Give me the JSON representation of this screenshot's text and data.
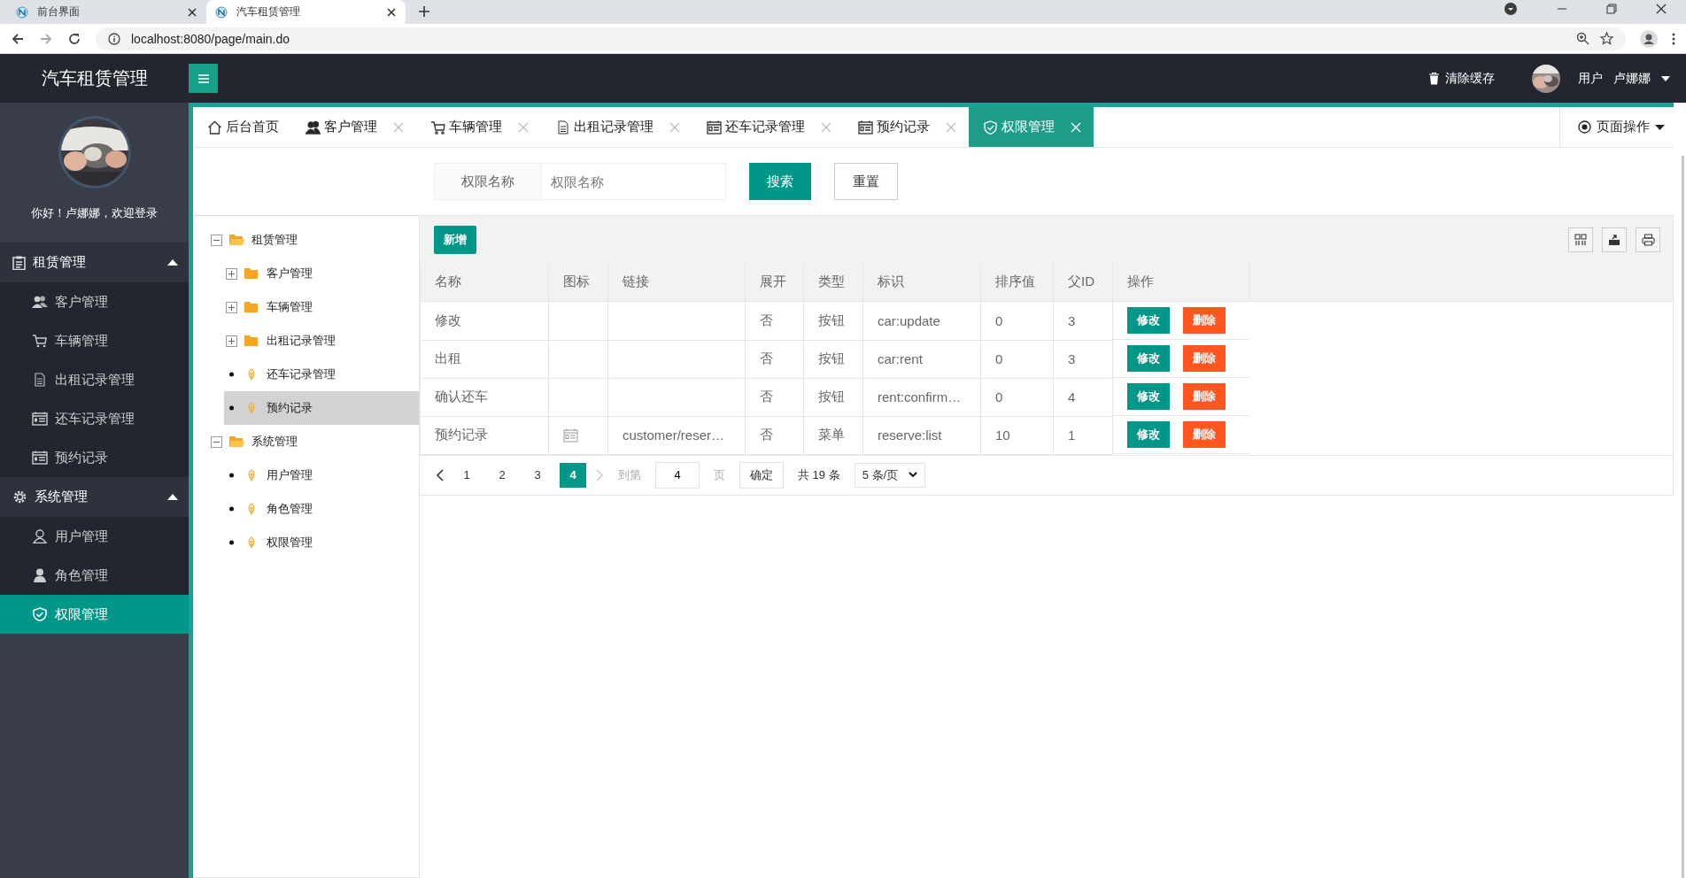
{
  "browser": {
    "tabs": [
      {
        "title": "前台界面",
        "selected": false
      },
      {
        "title": "汽车租赁管理",
        "selected": true
      }
    ],
    "address": "localhost:8080/page/main.do"
  },
  "header": {
    "title": "汽车租赁管理",
    "clear_cache": "清除缓存",
    "user_label": "用户",
    "user_name": "卢娜娜"
  },
  "sidebar": {
    "greeting": "你好！卢娜娜，欢迎登录",
    "groups": [
      {
        "label": "租赁管理",
        "expanded": true,
        "items": [
          {
            "label": "客户管理",
            "selected": false
          },
          {
            "label": "车辆管理",
            "selected": false
          },
          {
            "label": "出租记录管理",
            "selected": false
          },
          {
            "label": "还车记录管理",
            "selected": false
          },
          {
            "label": "预约记录",
            "selected": false
          }
        ]
      },
      {
        "label": "系统管理",
        "expanded": true,
        "items": [
          {
            "label": "用户管理",
            "selected": false
          },
          {
            "label": "角色管理",
            "selected": false
          },
          {
            "label": "权限管理",
            "selected": true
          }
        ]
      }
    ]
  },
  "page_tabs": [
    {
      "label": "后台首页",
      "selected": false,
      "closable": false
    },
    {
      "label": "客户管理",
      "selected": false,
      "closable": true
    },
    {
      "label": "车辆管理",
      "selected": false,
      "closable": true
    },
    {
      "label": "出租记录管理",
      "selected": false,
      "closable": true
    },
    {
      "label": "还车记录管理",
      "selected": false,
      "closable": true
    },
    {
      "label": "预约记录",
      "selected": false,
      "closable": true
    },
    {
      "label": "权限管理",
      "selected": true,
      "closable": true
    }
  ],
  "page_operations": "页面操作",
  "search": {
    "label": "权限名称",
    "placeholder": "权限名称",
    "search_button": "搜索",
    "reset_button": "重置"
  },
  "tree": [
    {
      "label": "租赁管理",
      "kind": "folder",
      "expanded": true,
      "selected": false,
      "children": [
        {
          "label": "客户管理",
          "kind": "folder",
          "expanded": false,
          "selected": false
        },
        {
          "label": "车辆管理",
          "kind": "folder",
          "expanded": false,
          "selected": false
        },
        {
          "label": "出租记录管理",
          "kind": "folder",
          "expanded": false,
          "selected": false
        },
        {
          "label": "还车记录管理",
          "kind": "leaf",
          "selected": false
        },
        {
          "label": "预约记录",
          "kind": "leaf",
          "selected": true
        }
      ]
    },
    {
      "label": "系统管理",
      "kind": "folder",
      "expanded": true,
      "selected": false,
      "children": [
        {
          "label": "用户管理",
          "kind": "leaf",
          "selected": false
        },
        {
          "label": "角色管理",
          "kind": "leaf",
          "selected": false
        },
        {
          "label": "权限管理",
          "kind": "leaf",
          "selected": false
        }
      ]
    }
  ],
  "table": {
    "add_button": "新增",
    "columns": [
      "名称",
      "图标",
      "链接",
      "展开",
      "类型",
      "标识",
      "排序值",
      "父ID",
      "操作"
    ],
    "rows": [
      {
        "name": "修改",
        "has_icon": false,
        "link": "",
        "expand": "否",
        "type": "按钮",
        "code": "car:update",
        "order": "0",
        "parent_id": "3",
        "edit": "修改",
        "delete": "删除"
      },
      {
        "name": "出租",
        "has_icon": false,
        "link": "",
        "expand": "否",
        "type": "按钮",
        "code": "car:rent",
        "order": "0",
        "parent_id": "3",
        "edit": "修改",
        "delete": "删除"
      },
      {
        "name": "确认还车",
        "has_icon": false,
        "link": "",
        "expand": "否",
        "type": "按钮",
        "code": "rent:confirm…",
        "order": "0",
        "parent_id": "4",
        "edit": "修改",
        "delete": "删除"
      },
      {
        "name": "预约记录",
        "has_icon": true,
        "link": "customer/reser…",
        "expand": "否",
        "type": "菜单",
        "code": "reserve:list",
        "order": "10",
        "parent_id": "1",
        "edit": "修改",
        "delete": "删除"
      }
    ]
  },
  "pagination": {
    "pages": [
      {
        "label": "1",
        "selected": false
      },
      {
        "label": "2",
        "selected": false
      },
      {
        "label": "3",
        "selected": false
      },
      {
        "label": "4",
        "selected": true
      }
    ],
    "prev_disabled": false,
    "next_disabled": true,
    "goto_label": "到第",
    "goto_value": "4",
    "page_unit": "页",
    "confirm": "确定",
    "total": "共 19 条",
    "page_size": "5 条/页"
  }
}
